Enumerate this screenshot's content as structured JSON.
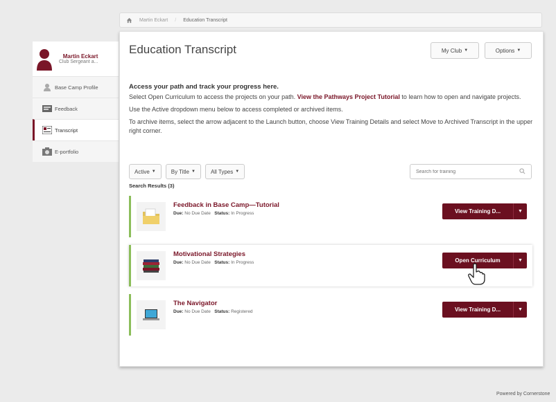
{
  "breadcrumb": {
    "items": [
      "Martin Eckart",
      "Education Transcript"
    ]
  },
  "profile": {
    "name": "Martin Eckart",
    "role": "Club Sergeant a..."
  },
  "sidebar": {
    "items": [
      {
        "label": "Base Camp Profile"
      },
      {
        "label": "Feedback"
      },
      {
        "label": "Transcript"
      },
      {
        "label": "E-portfolio"
      }
    ]
  },
  "header": {
    "title": "Education Transcript",
    "my_club_label": "My Club",
    "options_label": "Options"
  },
  "intro": {
    "lead": "Access your path and track your progress here.",
    "line1_before": "Select Open Curriculum to access the projects on your path. ",
    "line1_link": "View the Pathways Project Tutorial",
    "line1_after": " to learn how to open and navigate projects.",
    "line2": "Use the Active dropdown menu below to access completed or archived items.",
    "line3": "To archive items, select the arrow adjacent to the Launch button, choose View Training Details and select Move to Archived Transcript in the upper right corner."
  },
  "filters": {
    "active": "Active",
    "by_title": "By Title",
    "all_types": "All Types"
  },
  "search": {
    "placeholder": "Search for training"
  },
  "results_count": "Search Results (3)",
  "labels": {
    "due": "Due:",
    "status": "Status:"
  },
  "results": [
    {
      "title": "Feedback in Base Camp—Tutorial",
      "due": "No Due Date",
      "status": "In Progress",
      "action": "View Training D...",
      "icon": "folder-icon"
    },
    {
      "title": "Motivational Strategies",
      "due": "No Due Date",
      "status": "In Progress",
      "action": "Open Curriculum",
      "icon": "books-icon"
    },
    {
      "title": "The Navigator",
      "due": "No Due Date",
      "status": "Registered",
      "action": "View Training D...",
      "icon": "laptop-icon"
    }
  ],
  "footer": {
    "powered": "Powered by Cornerstone"
  },
  "colors": {
    "brand": "#7a1628",
    "button": "#6b1020",
    "card_accent": "#8bbd5a"
  }
}
